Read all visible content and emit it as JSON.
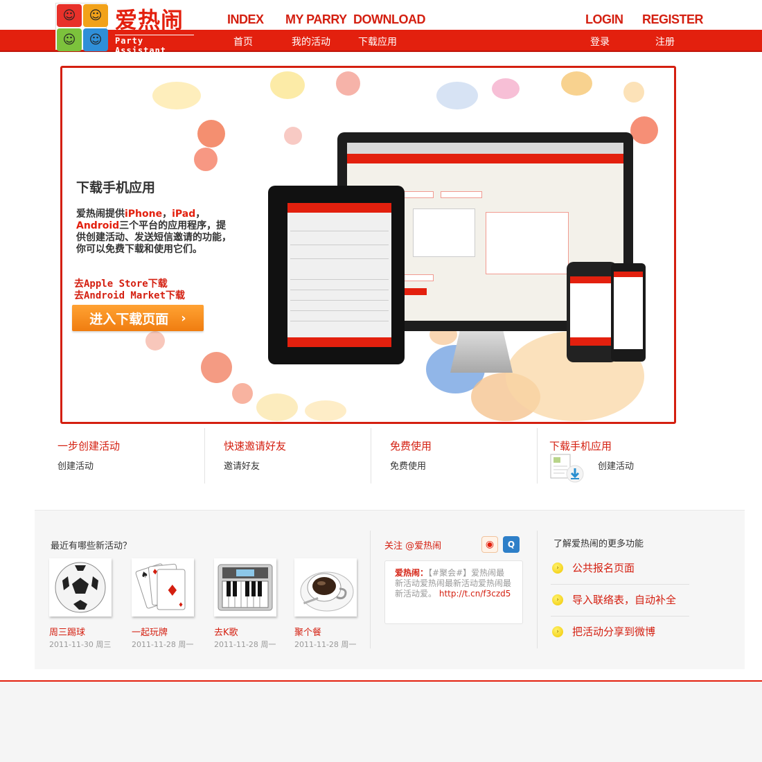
{
  "header": {
    "brand_title": "爱热闹",
    "brand_subtitle": "Party Assistant",
    "nav": [
      {
        "en": "INDEX",
        "cn": "首页"
      },
      {
        "en": "MY PARRY",
        "cn": "我的活动"
      },
      {
        "en": "DOWNLOAD",
        "cn": "下载应用"
      },
      {
        "en": "LOGIN",
        "cn": "登录"
      },
      {
        "en": "REGISTER",
        "cn": "注册"
      }
    ]
  },
  "banner": {
    "title": "下载手机应用",
    "desc_part1": "爱热闹提供",
    "desc_iphone": "iPhone",
    "desc_sep1": "，",
    "desc_ipad": "iPad",
    "desc_sep2": "，",
    "desc_android": "Android",
    "desc_part2": "三个平台的应用程序，提供创建活动、发送短信邀请的功能，你可以免费下载和使用它们。",
    "apple_link": "去Apple Store下载",
    "android_link": "去Android Market下载",
    "enter_button": "进入下载页面",
    "enter_arrow": "›"
  },
  "features": [
    {
      "title": "一步创建活动",
      "sub": "创建活动"
    },
    {
      "title": "快速邀请好友",
      "sub": "邀请好友"
    },
    {
      "title": "免费使用",
      "sub": "免费使用"
    },
    {
      "title": "下载手机应用",
      "sub": "创建活动"
    }
  ],
  "recent": {
    "title": "最近有哪些新活动？",
    "items": [
      {
        "name": "周三踢球",
        "date": "2011-11-30 周三",
        "icon": "soccer-ball-icon"
      },
      {
        "name": "一起玩牌",
        "date": "2011-11-28 周一",
        "icon": "playing-cards-icon"
      },
      {
        "name": "去K歌",
        "date": "2011-11-28 周一",
        "icon": "keyboard-piano-icon"
      },
      {
        "name": "聚个餐",
        "date": "2011-11-28 周一",
        "icon": "coffee-cup-icon"
      }
    ]
  },
  "follow": {
    "title": "关注 @爱热闹",
    "tweet_author": "爱热闹：",
    "tweet_text": "【#聚会#】爱热闹最新活动爱热闹最新活动爱热闹最新活动爱。",
    "tweet_link": "http://t.cn/f3czd5"
  },
  "more": {
    "title": "了解爱热闹的更多功能",
    "items": [
      {
        "label": "公共报名页面"
      },
      {
        "label": "导入联络表，自动补全"
      },
      {
        "label": "把活动分享到微博"
      }
    ]
  },
  "colors": {
    "brand_red": "#e3200e",
    "button_orange": "#f08a18",
    "link_red": "#d41f10"
  }
}
